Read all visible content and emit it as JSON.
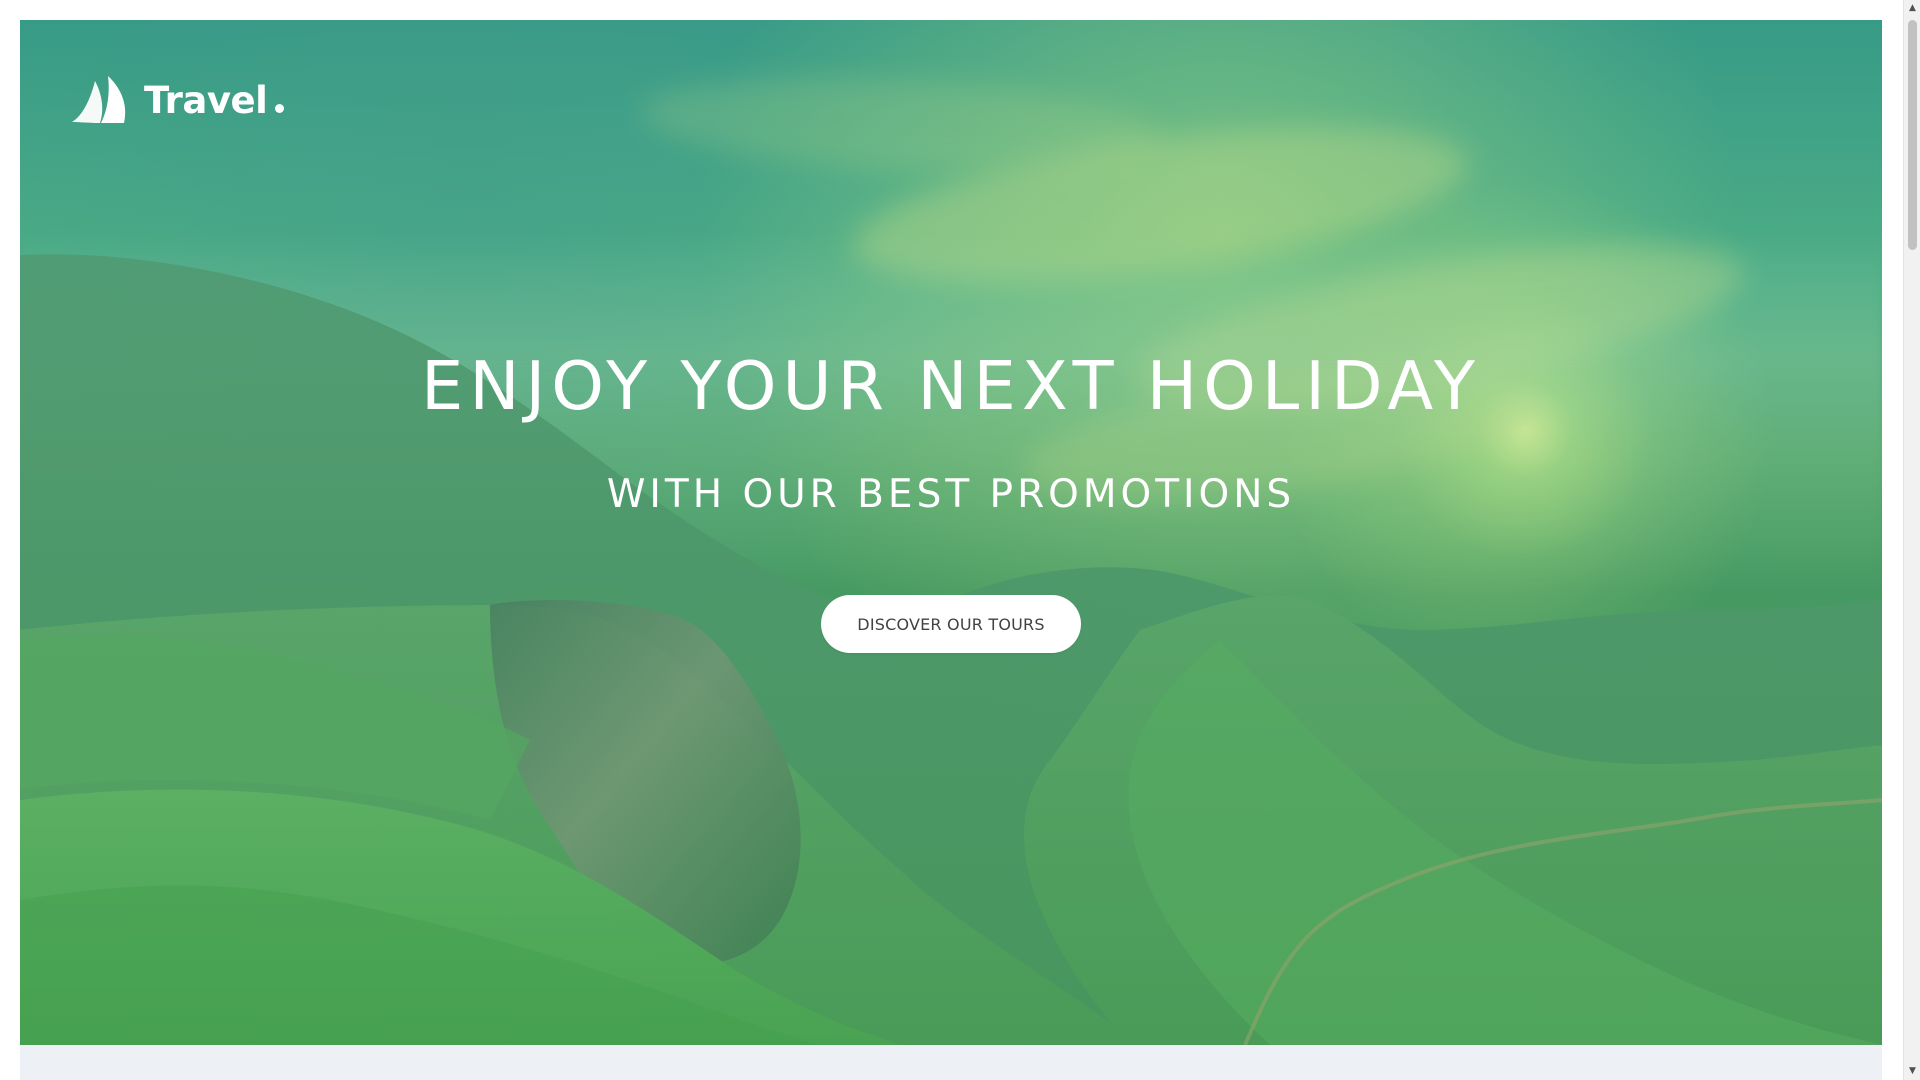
{
  "brand": {
    "name": "Travel",
    "icon": "sail-icon"
  },
  "hero": {
    "title": "ENJOY YOUR NEXT HOLIDAY",
    "subtitle": "WITH OUR BEST PROMOTIONS",
    "button_label": "DISCOVER OUR TOURS"
  },
  "scrollbar": {
    "up_icon": "▲",
    "down_icon": "▼"
  },
  "colors": {
    "hero_green": "#4ea75b",
    "hero_teal": "#3d9f8c",
    "button_background": "#ffffff",
    "button_text": "#424242",
    "page_background": "#ffffff",
    "section_background": "#edf1f5"
  }
}
